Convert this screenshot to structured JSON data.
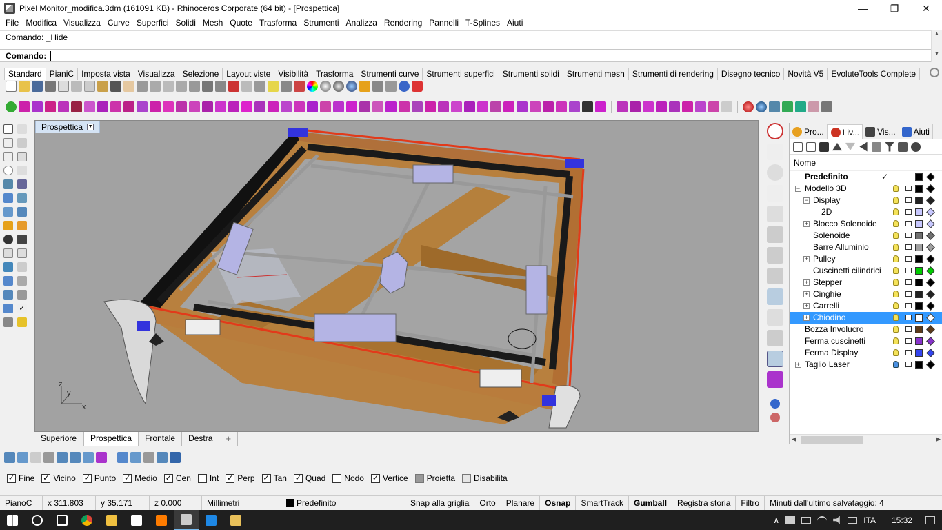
{
  "window": {
    "title": "Pixel Monitor_modifica.3dm (161091 KB) - Rhinoceros Corporate (64 bit) - [Prospettica]",
    "minimize": "—",
    "maximize": "❐",
    "close": "✕"
  },
  "menu": [
    "File",
    "Modifica",
    "Visualizza",
    "Curve",
    "Superfici",
    "Solidi",
    "Mesh",
    "Quote",
    "Trasforma",
    "Strumenti",
    "Analizza",
    "Rendering",
    "Pannelli",
    "T-Splines",
    "Aiuti"
  ],
  "command": {
    "history": "Comando: _Hide",
    "prompt_label": "Comando:",
    "input_value": ""
  },
  "toolbar_tabs": [
    "Standard",
    "PianiC",
    "Imposta vista",
    "Visualizza",
    "Selezione",
    "Layout viste",
    "Visibilità",
    "Trasforma",
    "Strumenti curve",
    "Strumenti superfici",
    "Strumenti solidi",
    "Strumenti mesh",
    "Strumenti di rendering",
    "Disegno tecnico",
    "Novità V5",
    "EvoluteTools Complete"
  ],
  "viewport": {
    "title": "Prospettica",
    "dropdown_glyph": "▼",
    "axis_x": "x",
    "axis_y": "y",
    "axis_z": "z"
  },
  "viewport_tabs": [
    "Superiore",
    "Prospettica",
    "Frontale",
    "Destra"
  ],
  "viewport_tab_add": "+",
  "panel": {
    "tabs": [
      {
        "label": "Pro...",
        "icon": "properties-icon",
        "color": "#e7a020"
      },
      {
        "label": "Liv...",
        "icon": "layers-icon",
        "color": "#cc3322"
      },
      {
        "label": "Vis...",
        "icon": "display-icon",
        "color": "#444444"
      },
      {
        "label": "Aiuti",
        "icon": "help-icon",
        "color": "#3366cc"
      }
    ],
    "column_name": "Nome",
    "layers": [
      {
        "name": "Predefinito",
        "indent": 0,
        "expand": "",
        "bold": true,
        "current": "✓",
        "bulb": "",
        "swatch": "#000000",
        "diamond": "#000000"
      },
      {
        "name": "Modello 3D",
        "indent": 0,
        "expand": "−",
        "bold": false,
        "current": "",
        "bulb": "on",
        "swatch": "#000000",
        "diamond": "#000000"
      },
      {
        "name": "Display",
        "indent": 1,
        "expand": "−",
        "bold": false,
        "current": "",
        "bulb": "on",
        "swatch": "#222222",
        "diamond": "#222222"
      },
      {
        "name": "2D",
        "indent": 2,
        "expand": "",
        "bold": false,
        "current": "",
        "bulb": "on",
        "swatch": "#c8c8ff",
        "diamond": "#c8c8ff"
      },
      {
        "name": "Blocco Solenoide",
        "indent": 1,
        "expand": "+",
        "bold": false,
        "current": "",
        "bulb": "on",
        "swatch": "#c8c8ff",
        "diamond": "#c8c8ff"
      },
      {
        "name": "Solenoide",
        "indent": 1,
        "expand": "",
        "bold": false,
        "current": "",
        "bulb": "on",
        "swatch": "#707070",
        "diamond": "#707070"
      },
      {
        "name": "Barre Alluminio",
        "indent": 1,
        "expand": "",
        "bold": false,
        "current": "",
        "bulb": "on",
        "swatch": "#a0a0a0",
        "diamond": "#a0a0a0"
      },
      {
        "name": "Pulley",
        "indent": 1,
        "expand": "+",
        "bold": false,
        "current": "",
        "bulb": "on",
        "swatch": "#000000",
        "diamond": "#000000"
      },
      {
        "name": "Cuscinetti cilindrici",
        "indent": 1,
        "expand": "",
        "bold": false,
        "current": "",
        "bulb": "on",
        "swatch": "#00cc00",
        "diamond": "#00cc00"
      },
      {
        "name": "Stepper",
        "indent": 1,
        "expand": "+",
        "bold": false,
        "current": "",
        "bulb": "on",
        "swatch": "#000000",
        "diamond": "#000000"
      },
      {
        "name": "Cinghie",
        "indent": 1,
        "expand": "+",
        "bold": false,
        "current": "",
        "bulb": "on",
        "swatch": "#222222",
        "diamond": "#222222"
      },
      {
        "name": "Carrelli",
        "indent": 1,
        "expand": "+",
        "bold": false,
        "current": "",
        "bulb": "on",
        "swatch": "#000000",
        "diamond": "#000000"
      },
      {
        "name": "Chiodino",
        "indent": 1,
        "expand": "+",
        "bold": false,
        "current": "",
        "bulb": "on",
        "swatch": "#ffffff",
        "diamond": "#ffffff",
        "selected": true
      },
      {
        "name": "Bozza Involucro",
        "indent": 0,
        "expand": "",
        "bold": false,
        "current": "",
        "bulb": "on",
        "swatch": "#5a3a1a",
        "diamond": "#5a3a1a"
      },
      {
        "name": "Ferma cuscinetti",
        "indent": 0,
        "expand": "",
        "bold": false,
        "current": "",
        "bulb": "on",
        "swatch": "#8833cc",
        "diamond": "#8833cc"
      },
      {
        "name": "Ferma Display",
        "indent": 0,
        "expand": "",
        "bold": false,
        "current": "",
        "bulb": "on",
        "swatch": "#3344ee",
        "diamond": "#3344ee"
      },
      {
        "name": "Taglio Laser",
        "indent": 0,
        "expand": "+",
        "bold": false,
        "current": "",
        "bulb": "blue",
        "swatch": "#000000",
        "diamond": "#000000"
      }
    ]
  },
  "osnap": [
    {
      "label": "Fine",
      "checked": true
    },
    {
      "label": "Vicino",
      "checked": true
    },
    {
      "label": "Punto",
      "checked": true
    },
    {
      "label": "Medio",
      "checked": true
    },
    {
      "label": "Cen",
      "checked": true
    },
    {
      "label": "Int",
      "checked": false
    },
    {
      "label": "Perp",
      "checked": true
    },
    {
      "label": "Tan",
      "checked": true
    },
    {
      "label": "Quad",
      "checked": true
    },
    {
      "label": "Nodo",
      "checked": false
    },
    {
      "label": "Vertice",
      "checked": true
    },
    {
      "label": "Proietta",
      "checked": false,
      "style": "square"
    },
    {
      "label": "Disabilita",
      "checked": false,
      "style": "square"
    }
  ],
  "check_glyph": "✓",
  "status": {
    "cplane": "PianoC",
    "x": "x 311.803",
    "y": "y 35.171",
    "z": "z 0.000",
    "units": "Millimetri",
    "layer": "Predefinito",
    "grid_snap": "Snap alla griglia",
    "ortho": "Orto",
    "planar": "Planare",
    "osnap": "Osnap",
    "smarttrack": "SmartTrack",
    "gumball": "Gumball",
    "history": "Registra storia",
    "filter": "Filtro",
    "autosave": "Minuti dall'ultimo salvataggio: 4"
  },
  "taskbar": {
    "language": "ITA",
    "time": "15:32",
    "tray_up": "∧"
  }
}
